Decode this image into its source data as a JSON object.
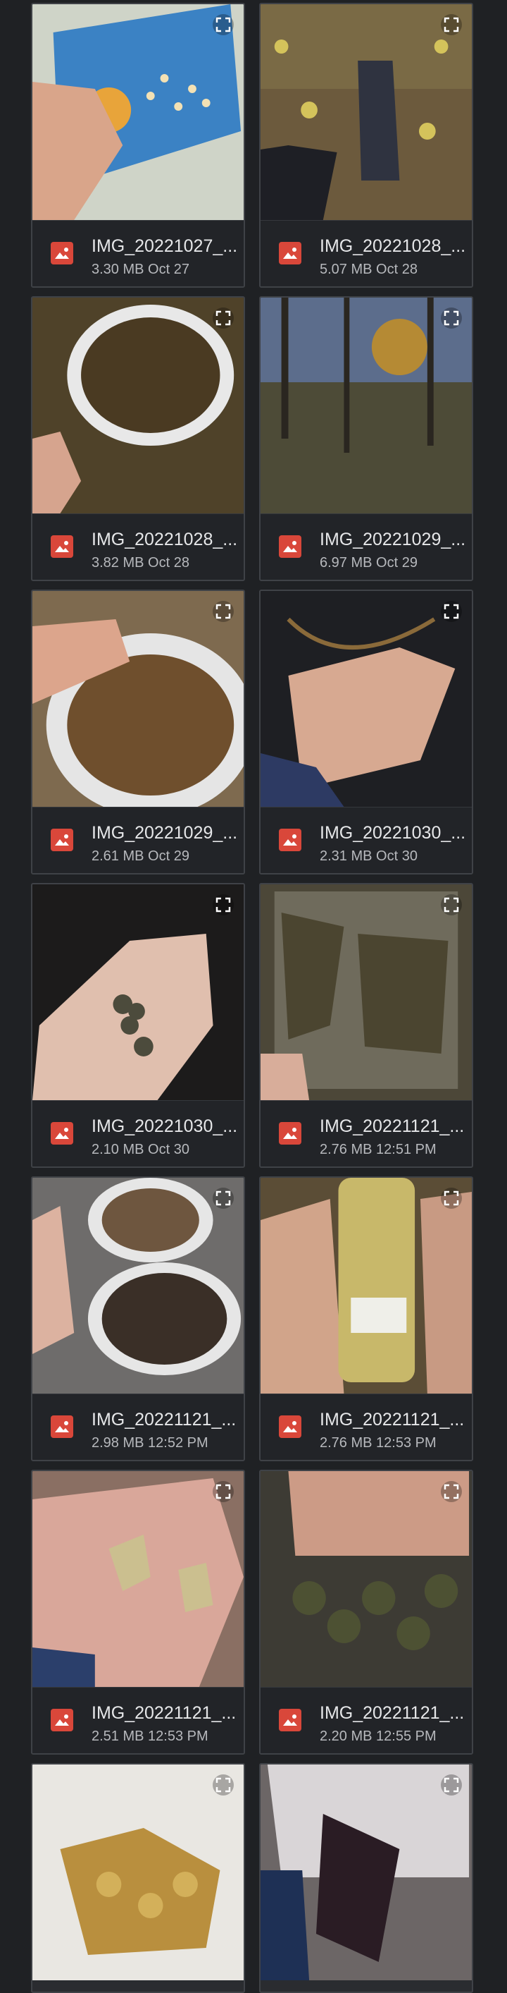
{
  "gallery": {
    "items": [
      {
        "name": "IMG_20221027_...",
        "size": "3.30 MB",
        "date": "Oct 27",
        "thumb_bg": "#6c5a3d",
        "icon": "image-icon"
      },
      {
        "name": "IMG_20221028_...",
        "size": "5.07 MB",
        "date": "Oct 28",
        "thumb_bg": "#5b4c2f",
        "icon": "image-icon"
      },
      {
        "name": "IMG_20221028_...",
        "size": "3.82 MB",
        "date": "Oct 28",
        "thumb_bg": "#4f4229",
        "icon": "image-icon"
      },
      {
        "name": "IMG_20221029_...",
        "size": "6.97 MB",
        "date": "Oct 29",
        "thumb_bg": "#4d4b37",
        "icon": "image-icon"
      },
      {
        "name": "IMG_20221029_...",
        "size": "2.61 MB",
        "date": "Oct 29",
        "thumb_bg": "#7e6a4f",
        "icon": "image-icon"
      },
      {
        "name": "IMG_20221030_...",
        "size": "2.31 MB",
        "date": "Oct 30",
        "thumb_bg": "#1e1f23",
        "icon": "image-icon"
      },
      {
        "name": "IMG_20221030_...",
        "size": "2.10 MB",
        "date": "Oct 30",
        "thumb_bg": "#1c1b1b",
        "icon": "image-icon"
      },
      {
        "name": "IMG_20221121_...",
        "size": "2.76 MB",
        "date": "12:51 PM",
        "thumb_bg": "#4c4738",
        "icon": "image-icon"
      },
      {
        "name": "IMG_20221121_...",
        "size": "2.98 MB",
        "date": "12:52 PM",
        "thumb_bg": "#6e6c6b",
        "icon": "image-icon"
      },
      {
        "name": "IMG_20221121_...",
        "size": "2.76 MB",
        "date": "12:53 PM",
        "thumb_bg": "#5b4d36",
        "icon": "image-icon"
      },
      {
        "name": "IMG_20221121_...",
        "size": "2.51 MB",
        "date": "12:53 PM",
        "thumb_bg": "#8a6f63",
        "icon": "image-icon"
      },
      {
        "name": "IMG_20221121_...",
        "size": "2.20 MB",
        "date": "12:55 PM",
        "thumb_bg": "#3d3b34",
        "icon": "image-icon"
      },
      {
        "name": "",
        "size": "",
        "date": "",
        "thumb_bg": "#d9d2c2",
        "icon": ""
      },
      {
        "name": "",
        "size": "",
        "date": "",
        "thumb_bg": "#6c6666",
        "icon": ""
      }
    ]
  },
  "colors": {
    "background": "#1f2124",
    "card_border": "#3f4247",
    "file_icon": "#d9473a"
  }
}
